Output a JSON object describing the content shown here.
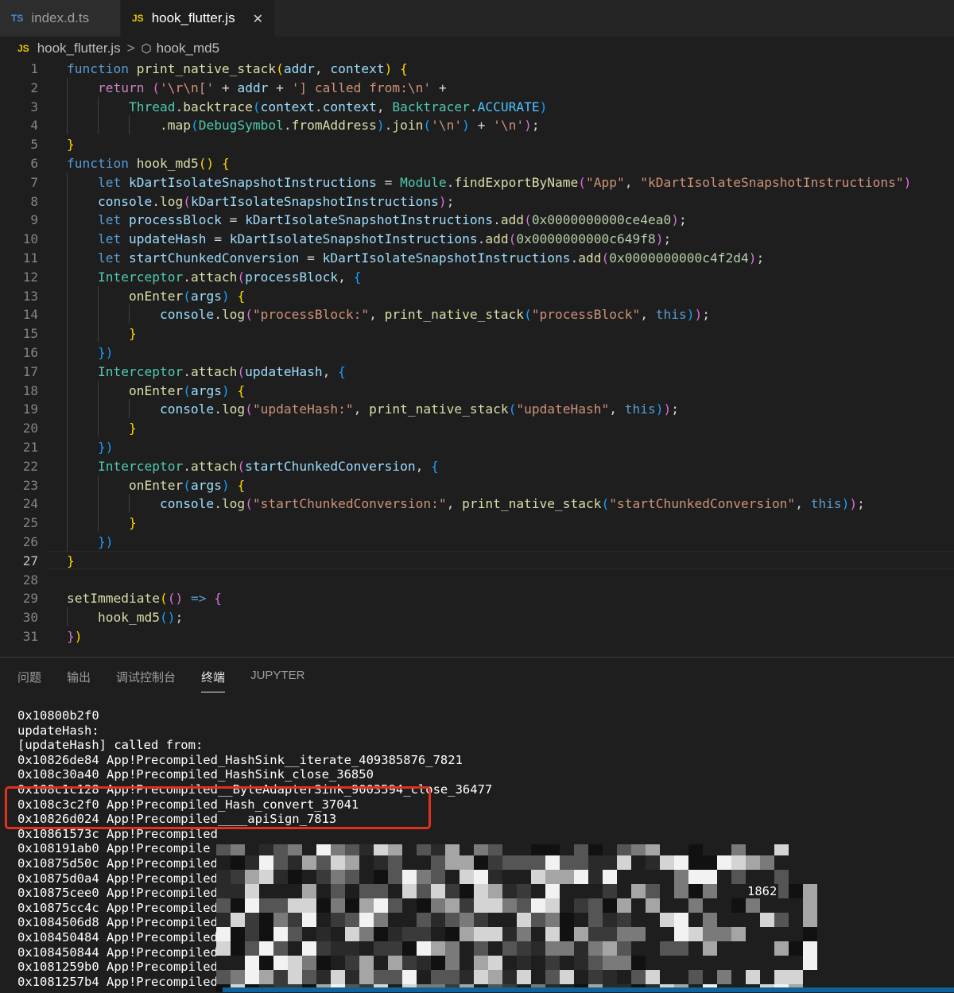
{
  "tabs": [
    {
      "icon": "TS",
      "label": "index.d.ts",
      "active": false
    },
    {
      "icon": "JS",
      "label": "hook_flutter.js",
      "active": true,
      "close": "✕"
    }
  ],
  "breadcrumb": {
    "file_icon": "JS",
    "file": "hook_flutter.js",
    "separator": ">",
    "symbol_icon": "⬡",
    "symbol": "hook_md5"
  },
  "editor": {
    "current_line": 27,
    "lines": [
      [
        [
          "kw",
          "function"
        ],
        [
          "p",
          " "
        ],
        [
          "fn",
          "print_native_stack"
        ],
        [
          "b1",
          "("
        ],
        [
          "var",
          "addr"
        ],
        [
          "p",
          ", "
        ],
        [
          "var",
          "context"
        ],
        [
          "b1",
          ")"
        ],
        [
          "p",
          " "
        ],
        [
          "b1",
          "{"
        ]
      ],
      [
        [
          "p",
          "    "
        ],
        [
          "ctl",
          "return"
        ],
        [
          "p",
          " "
        ],
        [
          "b2",
          "("
        ],
        [
          "str",
          "'\\r\\n['"
        ],
        [
          "p",
          " + "
        ],
        [
          "var",
          "addr"
        ],
        [
          "p",
          " + "
        ],
        [
          "str",
          "'] called from:\\n'"
        ],
        [
          "p",
          " +"
        ]
      ],
      [
        [
          "p",
          "        "
        ],
        [
          "cls",
          "Thread"
        ],
        [
          "p",
          "."
        ],
        [
          "fn",
          "backtrace"
        ],
        [
          "b3",
          "("
        ],
        [
          "var",
          "context"
        ],
        [
          "p",
          "."
        ],
        [
          "var",
          "context"
        ],
        [
          "p",
          ", "
        ],
        [
          "cls",
          "Backtracer"
        ],
        [
          "p",
          "."
        ],
        [
          "cst",
          "ACCURATE"
        ],
        [
          "b3",
          ")"
        ]
      ],
      [
        [
          "p",
          "            ."
        ],
        [
          "fn",
          "map"
        ],
        [
          "b3",
          "("
        ],
        [
          "cls",
          "DebugSymbol"
        ],
        [
          "p",
          "."
        ],
        [
          "fn",
          "fromAddress"
        ],
        [
          "b3",
          ")"
        ],
        [
          "p",
          "."
        ],
        [
          "fn",
          "join"
        ],
        [
          "b3",
          "("
        ],
        [
          "str",
          "'\\n'"
        ],
        [
          "b3",
          ")"
        ],
        [
          "p",
          " + "
        ],
        [
          "str",
          "'\\n'"
        ],
        [
          "b2",
          ")"
        ],
        [
          "p",
          ";"
        ]
      ],
      [
        [
          "b1",
          "}"
        ]
      ],
      [
        [
          "kw",
          "function"
        ],
        [
          "p",
          " "
        ],
        [
          "fn",
          "hook_md5"
        ],
        [
          "b1",
          "()"
        ],
        [
          "p",
          " "
        ],
        [
          "b1",
          "{"
        ]
      ],
      [
        [
          "p",
          "    "
        ],
        [
          "kw",
          "let"
        ],
        [
          "p",
          " "
        ],
        [
          "var",
          "kDartIsolateSnapshotInstructions"
        ],
        [
          "p",
          " = "
        ],
        [
          "cls",
          "Module"
        ],
        [
          "p",
          "."
        ],
        [
          "fn",
          "findExportByName"
        ],
        [
          "b2",
          "("
        ],
        [
          "str",
          "\"App\""
        ],
        [
          "p",
          ", "
        ],
        [
          "str",
          "\"kDartIsolateSnapshotInstructions\""
        ],
        [
          "b2",
          ")"
        ]
      ],
      [
        [
          "p",
          "    "
        ],
        [
          "var",
          "console"
        ],
        [
          "p",
          "."
        ],
        [
          "fn",
          "log"
        ],
        [
          "b2",
          "("
        ],
        [
          "var",
          "kDartIsolateSnapshotInstructions"
        ],
        [
          "b2",
          ")"
        ],
        [
          "p",
          ";"
        ]
      ],
      [
        [
          "p",
          "    "
        ],
        [
          "kw",
          "let"
        ],
        [
          "p",
          " "
        ],
        [
          "var",
          "processBlock"
        ],
        [
          "p",
          " = "
        ],
        [
          "var",
          "kDartIsolateSnapshotInstructions"
        ],
        [
          "p",
          "."
        ],
        [
          "fn",
          "add"
        ],
        [
          "b2",
          "("
        ],
        [
          "num",
          "0x0000000000ce4ea0"
        ],
        [
          "b2",
          ")"
        ],
        [
          "p",
          ";"
        ]
      ],
      [
        [
          "p",
          "    "
        ],
        [
          "kw",
          "let"
        ],
        [
          "p",
          " "
        ],
        [
          "var",
          "updateHash"
        ],
        [
          "p",
          " = "
        ],
        [
          "var",
          "kDartIsolateSnapshotInstructions"
        ],
        [
          "p",
          "."
        ],
        [
          "fn",
          "add"
        ],
        [
          "b2",
          "("
        ],
        [
          "num",
          "0x0000000000c649f8"
        ],
        [
          "b2",
          ")"
        ],
        [
          "p",
          ";"
        ]
      ],
      [
        [
          "p",
          "    "
        ],
        [
          "kw",
          "let"
        ],
        [
          "p",
          " "
        ],
        [
          "var",
          "startChunkedConversion"
        ],
        [
          "p",
          " = "
        ],
        [
          "var",
          "kDartIsolateSnapshotInstructions"
        ],
        [
          "p",
          "."
        ],
        [
          "fn",
          "add"
        ],
        [
          "b2",
          "("
        ],
        [
          "num",
          "0x0000000000c4f2d4"
        ],
        [
          "b2",
          ")"
        ],
        [
          "p",
          ";"
        ]
      ],
      [
        [
          "p",
          "    "
        ],
        [
          "cls",
          "Interceptor"
        ],
        [
          "p",
          "."
        ],
        [
          "fn",
          "attach"
        ],
        [
          "b2",
          "("
        ],
        [
          "var",
          "processBlock"
        ],
        [
          "p",
          ", "
        ],
        [
          "b3",
          "{"
        ]
      ],
      [
        [
          "p",
          "        "
        ],
        [
          "fn",
          "onEnter"
        ],
        [
          "b3",
          "("
        ],
        [
          "var",
          "args"
        ],
        [
          "b3",
          ")"
        ],
        [
          "p",
          " "
        ],
        [
          "b1",
          "{"
        ]
      ],
      [
        [
          "p",
          "            "
        ],
        [
          "var",
          "console"
        ],
        [
          "p",
          "."
        ],
        [
          "fn",
          "log"
        ],
        [
          "b2",
          "("
        ],
        [
          "str",
          "\"processBlock:\""
        ],
        [
          "p",
          ", "
        ],
        [
          "fn",
          "print_native_stack"
        ],
        [
          "b3",
          "("
        ],
        [
          "str",
          "\"processBlock\""
        ],
        [
          "p",
          ", "
        ],
        [
          "kw",
          "this"
        ],
        [
          "b3",
          ")"
        ],
        [
          "b2",
          ")"
        ],
        [
          "p",
          ";"
        ]
      ],
      [
        [
          "p",
          "        "
        ],
        [
          "b1",
          "}"
        ]
      ],
      [
        [
          "p",
          "    "
        ],
        [
          "b3",
          "})"
        ]
      ],
      [
        [
          "p",
          "    "
        ],
        [
          "cls",
          "Interceptor"
        ],
        [
          "p",
          "."
        ],
        [
          "fn",
          "attach"
        ],
        [
          "b2",
          "("
        ],
        [
          "var",
          "updateHash"
        ],
        [
          "p",
          ", "
        ],
        [
          "b3",
          "{"
        ]
      ],
      [
        [
          "p",
          "        "
        ],
        [
          "fn",
          "onEnter"
        ],
        [
          "b3",
          "("
        ],
        [
          "var",
          "args"
        ],
        [
          "b3",
          ")"
        ],
        [
          "p",
          " "
        ],
        [
          "b1",
          "{"
        ]
      ],
      [
        [
          "p",
          "            "
        ],
        [
          "var",
          "console"
        ],
        [
          "p",
          "."
        ],
        [
          "fn",
          "log"
        ],
        [
          "b2",
          "("
        ],
        [
          "str",
          "\"updateHash:\""
        ],
        [
          "p",
          ", "
        ],
        [
          "fn",
          "print_native_stack"
        ],
        [
          "b3",
          "("
        ],
        [
          "str",
          "\"updateHash\""
        ],
        [
          "p",
          ", "
        ],
        [
          "kw",
          "this"
        ],
        [
          "b3",
          ")"
        ],
        [
          "b2",
          ")"
        ],
        [
          "p",
          ";"
        ]
      ],
      [
        [
          "p",
          "        "
        ],
        [
          "b1",
          "}"
        ]
      ],
      [
        [
          "p",
          "    "
        ],
        [
          "b3",
          "})"
        ]
      ],
      [
        [
          "p",
          "    "
        ],
        [
          "cls",
          "Interceptor"
        ],
        [
          "p",
          "."
        ],
        [
          "fn",
          "attach"
        ],
        [
          "b2",
          "("
        ],
        [
          "var",
          "startChunkedConversion"
        ],
        [
          "p",
          ", "
        ],
        [
          "b3",
          "{"
        ]
      ],
      [
        [
          "p",
          "        "
        ],
        [
          "fn",
          "onEnter"
        ],
        [
          "b3",
          "("
        ],
        [
          "var",
          "args"
        ],
        [
          "b3",
          ")"
        ],
        [
          "p",
          " "
        ],
        [
          "b1",
          "{"
        ]
      ],
      [
        [
          "p",
          "            "
        ],
        [
          "var",
          "console"
        ],
        [
          "p",
          "."
        ],
        [
          "fn",
          "log"
        ],
        [
          "b2",
          "("
        ],
        [
          "str",
          "\"startChunkedConversion:\""
        ],
        [
          "p",
          ", "
        ],
        [
          "fn",
          "print_native_stack"
        ],
        [
          "b3",
          "("
        ],
        [
          "str",
          "\"startChunkedConversion\""
        ],
        [
          "p",
          ", "
        ],
        [
          "kw",
          "this"
        ],
        [
          "b3",
          ")"
        ],
        [
          "b2",
          ")"
        ],
        [
          "p",
          ";"
        ]
      ],
      [
        [
          "p",
          "        "
        ],
        [
          "b1",
          "}"
        ]
      ],
      [
        [
          "p",
          "    "
        ],
        [
          "b3",
          "})"
        ]
      ],
      [
        [
          "b1",
          "}"
        ]
      ],
      [
        [
          "p",
          ""
        ]
      ],
      [
        [
          "fn",
          "setImmediate"
        ],
        [
          "b1",
          "("
        ],
        [
          "b2",
          "()"
        ],
        [
          "p",
          " "
        ],
        [
          "kw",
          "=>"
        ],
        [
          "p",
          " "
        ],
        [
          "b2",
          "{"
        ]
      ],
      [
        [
          "p",
          "    "
        ],
        [
          "fn",
          "hook_md5"
        ],
        [
          "b3",
          "()"
        ],
        [
          "p",
          ";"
        ]
      ],
      [
        [
          "b2",
          "}"
        ],
        [
          "b1",
          ")"
        ]
      ]
    ]
  },
  "panel": {
    "tabs": [
      {
        "label": "问题",
        "active": false
      },
      {
        "label": "输出",
        "active": false
      },
      {
        "label": "调试控制台",
        "active": false
      },
      {
        "label": "终端",
        "active": true
      },
      {
        "label": "JUPYTER",
        "active": false
      }
    ],
    "terminal_lines": [
      "0x10800b2f0",
      "updateHash:",
      "[updateHash] called from:",
      "0x10826de84 App!Precompiled_HashSink__iterate_409385876_7821",
      "0x108c30a40 App!Precompiled_HashSink_close_36850",
      "0x108c1c128 App!Precompiled__ByteAdapterSink_9003594_close_36477",
      "0x108c3c2f0 App!Precompiled_Hash_convert_37041",
      "0x10826d024 App!Precompiled____apiSign_7813",
      "0x10861573c App!Precompiled",
      "0x108191ab0 App!Precompile",
      "0x10875d50c App!Precompiled",
      "0x10875d0a4 App!Precompiled",
      "0x10875cee0 App!Precompiled",
      "0x10875cc4c App!Precompiled",
      "0x1084506d8 App!Precompiled",
      "0x108450484 App!Precompiled",
      "0x108450844 App!Precompiled",
      "0x1081259b0 App!Precompiled",
      "0x1081257b4 App!Precompiled"
    ],
    "terminal_fragment": "1862"
  }
}
